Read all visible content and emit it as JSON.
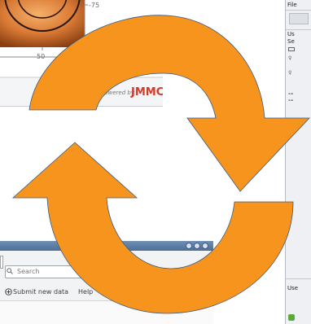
{
  "plot": {
    "ticks": {
      "x_label": "50",
      "y_label": "-75"
    },
    "branding": {
      "powered_by": "Powered by",
      "logo_text": "JMMC"
    }
  },
  "right_window": {
    "menu_file": "File",
    "section_label": "Us",
    "sub_label": "Se",
    "bottom_label": "Use"
  },
  "bottom_window": {
    "search_placeholder": "Search",
    "submit_label": "Submit new data",
    "help_label": "Help"
  },
  "overlay": {
    "icon": "refresh-icon",
    "color": "#F7941D",
    "stroke": "#3a5a80"
  }
}
